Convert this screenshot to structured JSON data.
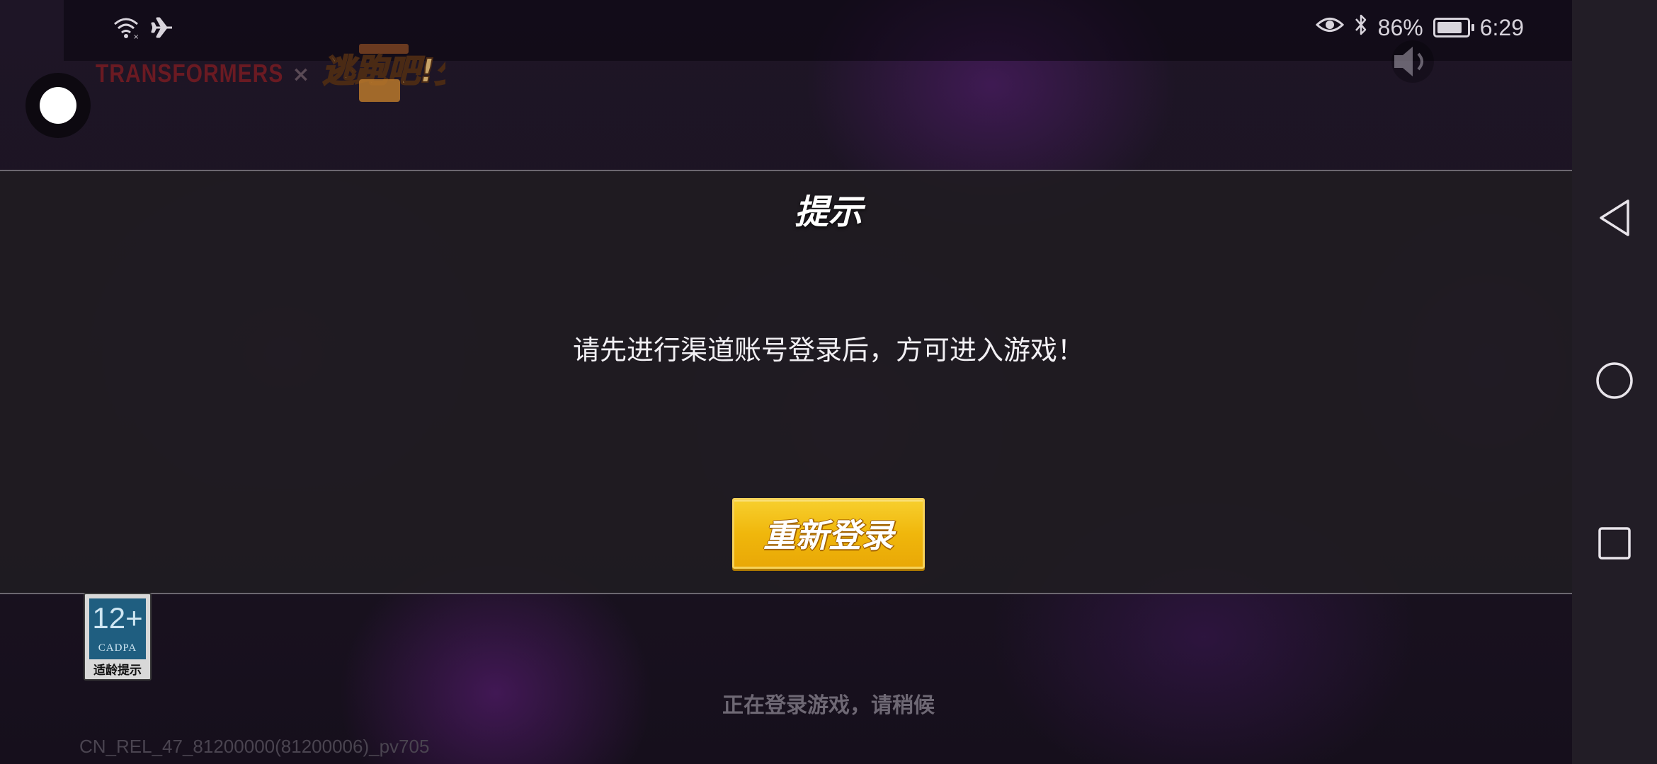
{
  "status_bar": {
    "left_icons": [
      "wifi-icon",
      "airplane-icon"
    ],
    "right_icons": [
      "eye-icon",
      "bluetooth-icon",
      "battery-icon"
    ],
    "battery_percent": "86%",
    "battery_level": 0.86,
    "time": "6:29"
  },
  "logo": {
    "brand_text": "TRANSFORMERS",
    "separator": "×",
    "game_logo_text": "逃跑吧!少年"
  },
  "dialog": {
    "title": "提示",
    "message": "请先进行渠道账号登录后，方可进入游戏！",
    "button_label": "重新登录"
  },
  "age_rating": {
    "age": "12+",
    "org": "CADPA",
    "label": "适龄提示"
  },
  "footer": {
    "loading_text": "正在登录游戏，请稍候",
    "version": "CN_REL_47_81200000(81200006)_pv705"
  },
  "nav_bar": {
    "buttons": [
      "back-icon",
      "home-icon",
      "recents-icon"
    ]
  },
  "colors": {
    "button_yellow": "#f0b70c",
    "dialog_bg": "#201c22",
    "navbar_bg": "#221d26",
    "accent_purple": "#5a1e78"
  }
}
